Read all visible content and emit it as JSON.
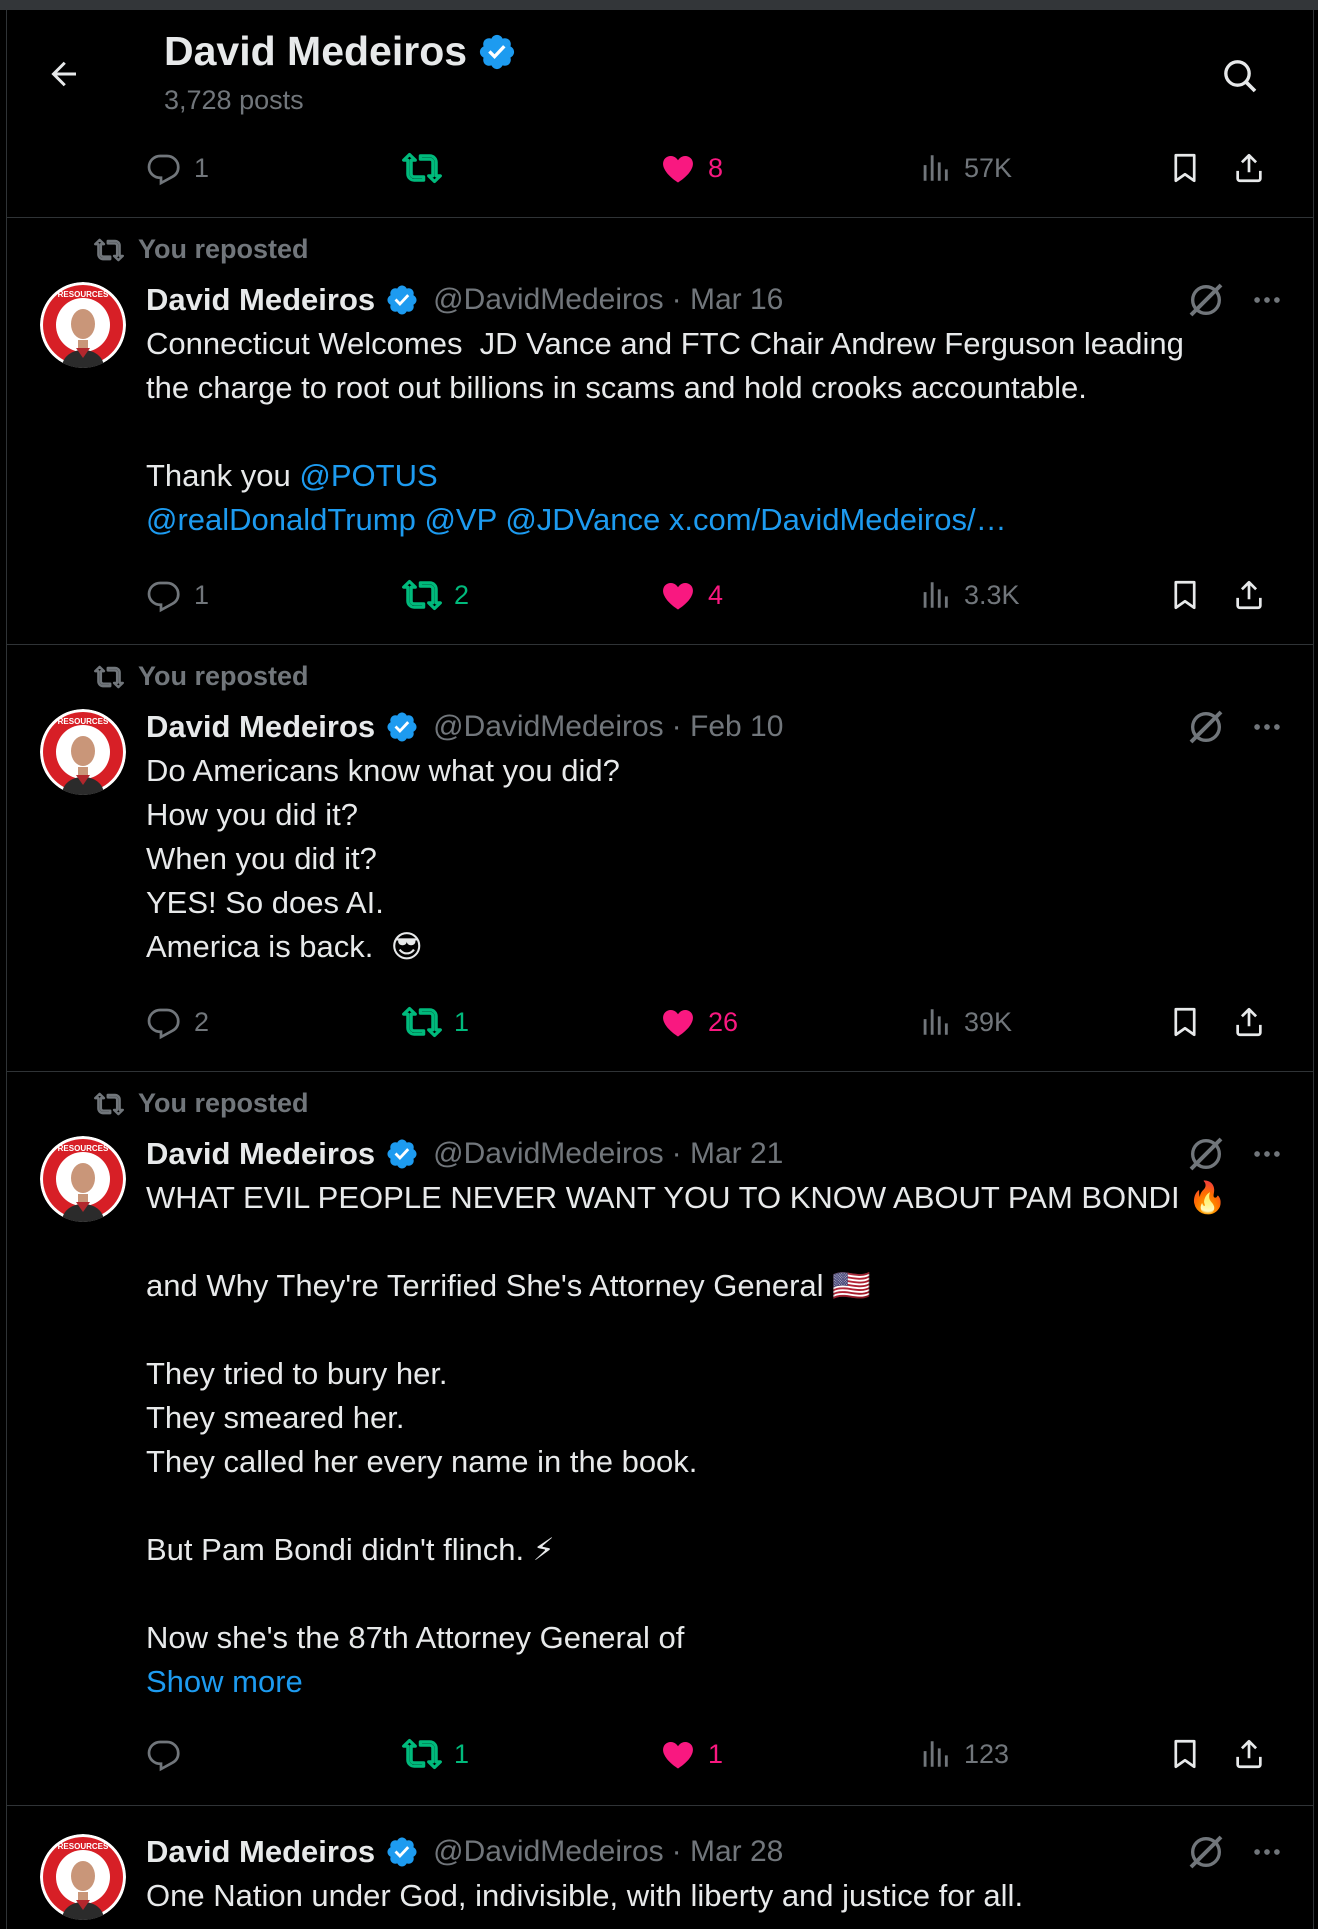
{
  "header": {
    "name": "David Medeiros",
    "posts_count": "3,728 posts"
  },
  "colors": {
    "background": "#000000",
    "text": "#e7e9ea",
    "muted": "#71767b",
    "link": "#1d9bf0",
    "repost_active": "#00ba7c",
    "like_active": "#f91880",
    "divider": "#2f3336",
    "verified": "#1d9bf0"
  },
  "icons": [
    "back-arrow-icon",
    "search-icon",
    "verified-badge-icon",
    "reply-icon",
    "repost-icon",
    "heart-icon",
    "views-icon",
    "bookmark-icon",
    "share-icon",
    "grok-icon",
    "more-icon"
  ],
  "top_post_actions": {
    "replies": "1",
    "reposts": "",
    "likes": "8",
    "views": "57K"
  },
  "posts": [
    {
      "repost_label": "You reposted",
      "author": "David Medeiros",
      "handle": "@DavidMedeiros",
      "date": "· Mar 16",
      "text_line1": "Connecticut Welcomes  JD Vance and FTC Chair Andrew Ferguson leading",
      "text_line2": "the charge to root out billions in scams and hold crooks accountable.",
      "text_thanks": "Thank you ",
      "mention_potus": "@POTUS",
      "mention_trump": "@realDonaldTrump",
      "mention_vp": "@VP",
      "mention_jdvance": "@JDVance",
      "link_url": "x.com/DavidMedeiros/…",
      "replies": "1",
      "reposts": "2",
      "likes": "4",
      "views": "3.3K"
    },
    {
      "repost_label": "You reposted",
      "author": "David Medeiros",
      "handle": "@DavidMedeiros",
      "date": "· Feb 10",
      "text": "Do Americans know what you did?\nHow you did it?\nWhen you did it?\nYES! So does AI.\nAmerica is back.  😎",
      "replies": "2",
      "reposts": "1",
      "likes": "26",
      "views": "39K"
    },
    {
      "repost_label": "You reposted",
      "author": "David Medeiros",
      "handle": "@DavidMedeiros",
      "date": "· Mar 21",
      "text": "WHAT EVIL PEOPLE NEVER WANT YOU TO KNOW ABOUT PAM BONDI 🔥\n\nand Why They're Terrified She's Attorney General 🇺🇸\n\nThey tried to bury her.\nThey smeared her.\nThey called her every name in the book.\n\nBut Pam Bondi didn't flinch. ⚡\n\nNow she's the 87th Attorney General of",
      "show_more": "Show more",
      "replies": "",
      "reposts": "1",
      "likes": "1",
      "views": "123"
    },
    {
      "author": "David Medeiros",
      "handle": "@DavidMedeiros",
      "date": "· Mar 28",
      "text": "One Nation under God, indivisible, with liberty and justice for all."
    }
  ]
}
